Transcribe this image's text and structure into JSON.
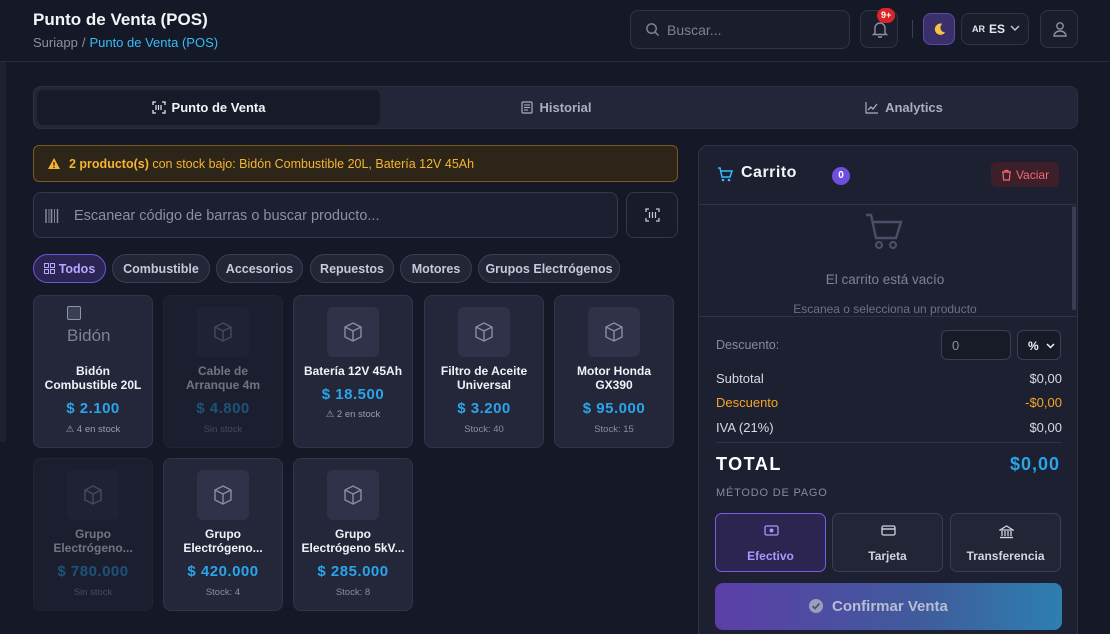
{
  "header": {
    "title": "Punto de Venta (POS)",
    "breadcrumb_root": "Suriapp",
    "breadcrumb_sep": "/",
    "breadcrumb_current": "Punto de Venta (POS)",
    "search_placeholder": "Buscar...",
    "notif_badge": "9+",
    "lang_flag": "AR",
    "lang_code": "ES"
  },
  "tabs": [
    {
      "label": "Punto de Venta",
      "icon": "barcode-icon",
      "active": true
    },
    {
      "label": "Historial",
      "icon": "receipt-icon",
      "active": false
    },
    {
      "label": "Analytics",
      "icon": "chart-icon",
      "active": false
    }
  ],
  "alert": {
    "count_text": "2 producto(s)",
    "message": " con stock bajo: Bidón Combustible 20L, Batería 12V 45Ah"
  },
  "scanner": {
    "placeholder": "Escanear código de barras o buscar producto..."
  },
  "categories": [
    {
      "label": "Todos",
      "active": true
    },
    {
      "label": "Combustible",
      "active": false
    },
    {
      "label": "Accesorios",
      "active": false
    },
    {
      "label": "Repuestos",
      "active": false
    },
    {
      "label": "Motores",
      "active": false
    },
    {
      "label": "Grupos Electrógenos",
      "active": false
    }
  ],
  "products": [
    {
      "name": "Bidón Combustible 20L",
      "price": "$ 2.100",
      "stock": "4 en stock",
      "low": true,
      "enabled": true,
      "image_alt": "Bidón"
    },
    {
      "name": "Cable de Arranque 4m",
      "price": "$ 4.800",
      "stock": "Sin stock",
      "low": false,
      "enabled": false
    },
    {
      "name": "Batería 12V 45Ah",
      "price": "$ 18.500",
      "stock": "2 en stock",
      "low": true,
      "enabled": true
    },
    {
      "name": "Filtro de Aceite Universal",
      "price": "$ 3.200",
      "stock": "Stock: 40",
      "low": false,
      "enabled": true
    },
    {
      "name": "Motor Honda GX390",
      "price": "$ 95.000",
      "stock": "Stock: 15",
      "low": false,
      "enabled": true
    },
    {
      "name": "Grupo Electrógeno...",
      "price": "$ 780.000",
      "stock": "Sin stock",
      "low": false,
      "enabled": false
    },
    {
      "name": "Grupo Electrógeno...",
      "price": "$ 420.000",
      "stock": "Stock: 4",
      "low": false,
      "enabled": true
    },
    {
      "name": "Grupo Electrógeno 5kV...",
      "price": "$ 285.000",
      "stock": "Stock: 8",
      "low": false,
      "enabled": true
    }
  ],
  "cart": {
    "title": "Carrito",
    "count": "0",
    "clear_label": "Vaciar",
    "empty_title": "El carrito está vacío",
    "empty_hint": "Escanea o selecciona un producto",
    "discount_label": "Descuento:",
    "discount_value": "0",
    "discount_type": "%",
    "subtotal_label": "Subtotal",
    "subtotal_value": "$0,00",
    "discount_row_label": "Descuento",
    "discount_row_value": "-$0,00",
    "iva_label": "IVA (21%)",
    "iva_value": "$0,00",
    "total_label": "TOTAL",
    "total_value": "$0,00",
    "payment_label": "MÉTODO DE PAGO",
    "payment_methods": [
      {
        "label": "Efectivo",
        "icon": "cash-icon",
        "active": true
      },
      {
        "label": "Tarjeta",
        "icon": "card-icon",
        "active": false
      },
      {
        "label": "Transferencia",
        "icon": "bank-icon",
        "active": false
      }
    ],
    "confirm_label": "Confirmar Venta"
  },
  "colors": {
    "accent": "#6d4fe0",
    "price": "#2aa4ea",
    "warning": "#f5a623",
    "danger": "#f26a72"
  }
}
